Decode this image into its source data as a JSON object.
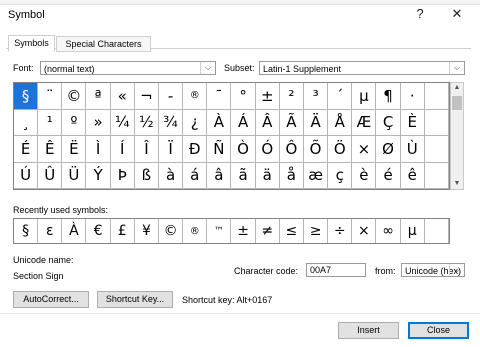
{
  "window": {
    "title": "Symbol",
    "help": "?",
    "close": "✕"
  },
  "tabs": [
    "Symbols",
    "Special Characters"
  ],
  "font": {
    "label": "Font:",
    "value": "(normal text)"
  },
  "subset": {
    "label": "Subset:",
    "value": "Latin-1 Supplement"
  },
  "symbols": [
    "§",
    "¨",
    "©",
    "ª",
    "«",
    "¬",
    "-",
    "®",
    "¯",
    "°",
    "±",
    "²",
    "³",
    "´",
    "µ",
    "¶",
    "·",
    "",
    "¸",
    "¹",
    "º",
    "»",
    "¼",
    "½",
    "¾",
    "¿",
    "À",
    "Á",
    "Â",
    "Ã",
    "Ä",
    "Å",
    "Æ",
    "Ç",
    "È",
    "",
    "É",
    "Ê",
    "Ë",
    "Ì",
    "Í",
    "Î",
    "Ï",
    "Ð",
    "Ñ",
    "Ò",
    "Ó",
    "Ô",
    "Õ",
    "Ö",
    "×",
    "Ø",
    "Ù",
    "",
    "Ú",
    "Û",
    "Ü",
    "Ý",
    "Þ",
    "ß",
    "à",
    "á",
    "â",
    "ã",
    "ä",
    "å",
    "æ",
    "ç",
    "è",
    "é",
    "ê",
    ""
  ],
  "recent": {
    "label": "Recently used symbols:",
    "items": [
      "§",
      "ε",
      "À",
      "€",
      "£",
      "¥",
      "©",
      "®",
      "™",
      "±",
      "≠",
      "≤",
      "≥",
      "÷",
      "×",
      "∞",
      "µ",
      ""
    ]
  },
  "unicode_name": {
    "label": "Unicode name:",
    "value": "Section Sign"
  },
  "character_code": {
    "label": "Character code:",
    "value": "00A7"
  },
  "from": {
    "label": "from:",
    "value": "Unicode (hex)"
  },
  "buttons": {
    "autocorrect": "AutoCorrect...",
    "shortcut_key": "Shortcut Key...",
    "insert": "Insert",
    "close": "Close"
  },
  "shortcut_text": "Shortcut key: Alt+0167"
}
